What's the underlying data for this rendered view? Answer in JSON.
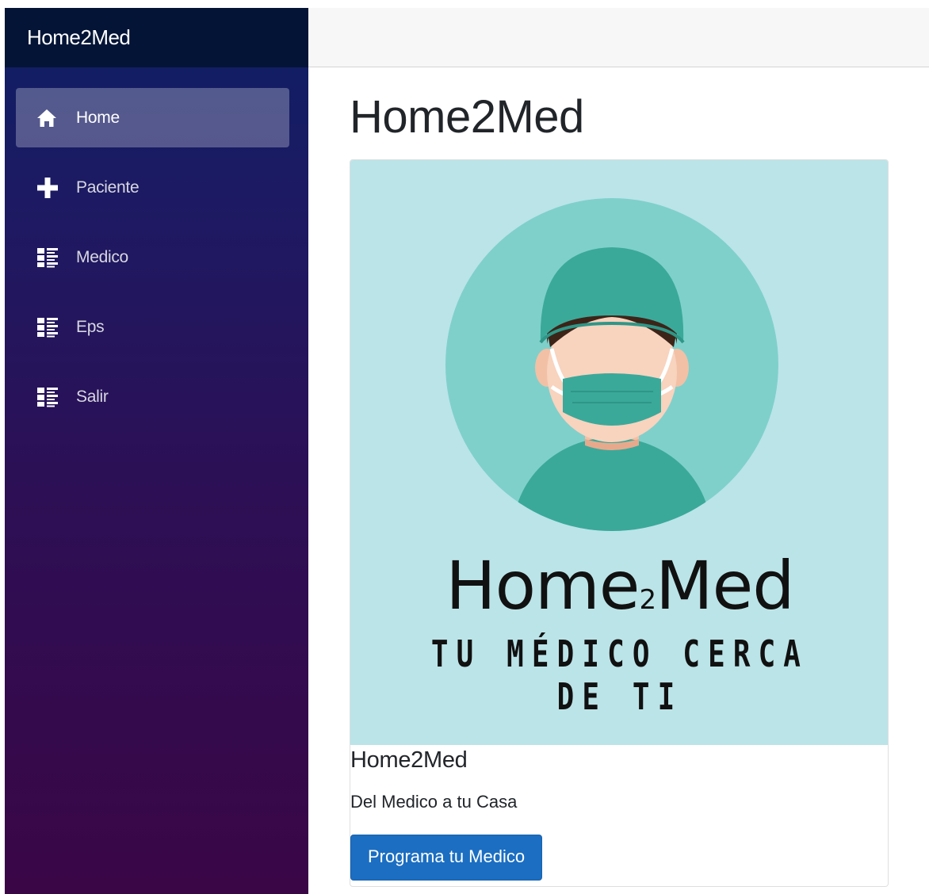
{
  "app": {
    "brand": "Home2Med"
  },
  "sidebar": {
    "items": [
      {
        "label": "Home",
        "icon": "home-icon",
        "active": true
      },
      {
        "label": "Paciente",
        "icon": "plus-icon",
        "active": false
      },
      {
        "label": "Medico",
        "icon": "list-icon",
        "active": false
      },
      {
        "label": "Eps",
        "icon": "list-icon",
        "active": false
      },
      {
        "label": "Salir",
        "icon": "list-icon",
        "active": false
      }
    ]
  },
  "main": {
    "title": "Home2Med",
    "card": {
      "image": {
        "logo_brand_main": "Home",
        "logo_brand_two": "2",
        "logo_brand_end": "Med",
        "tagline": "TU MÉDICO CERCA DE TI"
      },
      "title": "Home2Med",
      "text": "Del Medico a tu Casa",
      "button_label": "Programa tu Medico"
    }
  },
  "colors": {
    "brand_bar": "#031436",
    "sidebar_top": "#0d1f63",
    "sidebar_bottom": "#3a0646",
    "button": "#1b6ec2",
    "image_bg": "#bbe4e8",
    "circle": "#7fd0cb",
    "scrubs": "#3aa99a"
  }
}
